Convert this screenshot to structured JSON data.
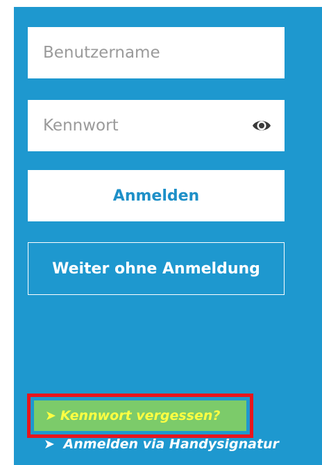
{
  "login": {
    "username_placeholder": "Benutzername",
    "password_placeholder": "Kennwort",
    "login_button": "Anmelden",
    "guest_button": "Weiter ohne Anmeldung"
  },
  "links": {
    "forgot_password": "Kennwort vergessen?",
    "handy_signature": "Anmelden via Handysignatur",
    "arrow_glyph": "➤"
  },
  "icons": {
    "password_toggle": "eye-icon"
  },
  "colors": {
    "panel_background": "#1e98cf",
    "login_text": "#1e90c8",
    "highlight_border": "#e8151c",
    "forgot_background": "#7ccb6a",
    "forgot_text": "#ffff42"
  }
}
